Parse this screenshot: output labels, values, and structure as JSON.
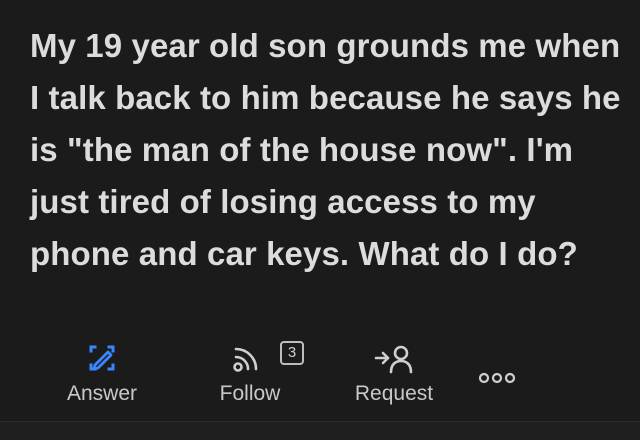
{
  "question": {
    "text": "My 19 year old son grounds me when I talk back to him because he says he is \"the man of the house now\". I'm just tired of losing access to my phone and car keys. What do I do?"
  },
  "actions": {
    "answer": {
      "label": "Answer",
      "icon": "pencil-square-icon",
      "color": "#3a86ff"
    },
    "follow": {
      "label": "Follow",
      "icon": "rss-icon",
      "count": "3"
    },
    "request": {
      "label": "Request",
      "icon": "request-person-icon"
    },
    "more": {
      "icon": "more-dots-icon"
    }
  },
  "colors": {
    "background": "#1b1b1b",
    "text": "#dcdcdc",
    "accent": "#3a86ff"
  }
}
